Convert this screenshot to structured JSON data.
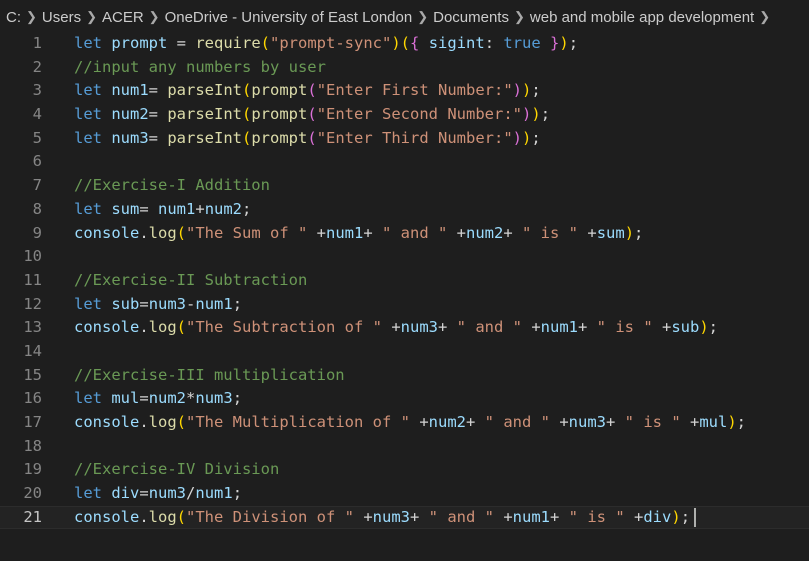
{
  "breadcrumb": [
    "C:",
    "Users",
    "ACER",
    "OneDrive - University of East London",
    "Documents",
    "web and mobile app development"
  ],
  "editor": {
    "current_line": 21,
    "lines": [
      {
        "n": "1",
        "t": [
          [
            "kw",
            "let"
          ],
          [
            "pl",
            " "
          ],
          [
            "var",
            "prompt"
          ],
          [
            "pl",
            " = "
          ],
          [
            "fn",
            "require"
          ],
          [
            "b1",
            "("
          ],
          [
            "str",
            "\"prompt-sync\""
          ],
          [
            "b1",
            ")("
          ],
          [
            "b2",
            "{"
          ],
          [
            "pl",
            " "
          ],
          [
            "var",
            "sigint"
          ],
          [
            "pl",
            ": "
          ],
          [
            "kw",
            "true"
          ],
          [
            "pl",
            " "
          ],
          [
            "b2",
            "}"
          ],
          [
            "b1",
            ")"
          ],
          [
            "pl",
            ";"
          ]
        ]
      },
      {
        "n": "2",
        "t": [
          [
            "cmt",
            "//input any numbers by user"
          ]
        ]
      },
      {
        "n": "3",
        "t": [
          [
            "kw",
            "let"
          ],
          [
            "pl",
            " "
          ],
          [
            "var",
            "num1"
          ],
          [
            "pl",
            "= "
          ],
          [
            "fn",
            "parseInt"
          ],
          [
            "b1",
            "("
          ],
          [
            "fn",
            "prompt"
          ],
          [
            "b2",
            "("
          ],
          [
            "str",
            "\"Enter First Number:\""
          ],
          [
            "b2",
            ")"
          ],
          [
            "b1",
            ")"
          ],
          [
            "pl",
            ";"
          ]
        ]
      },
      {
        "n": "4",
        "t": [
          [
            "kw",
            "let"
          ],
          [
            "pl",
            " "
          ],
          [
            "var",
            "num2"
          ],
          [
            "pl",
            "= "
          ],
          [
            "fn",
            "parseInt"
          ],
          [
            "b1",
            "("
          ],
          [
            "fn",
            "prompt"
          ],
          [
            "b2",
            "("
          ],
          [
            "str",
            "\"Enter Second Number:\""
          ],
          [
            "b2",
            ")"
          ],
          [
            "b1",
            ")"
          ],
          [
            "pl",
            ";"
          ]
        ]
      },
      {
        "n": "5",
        "t": [
          [
            "kw",
            "let"
          ],
          [
            "pl",
            " "
          ],
          [
            "var",
            "num3"
          ],
          [
            "pl",
            "= "
          ],
          [
            "fn",
            "parseInt"
          ],
          [
            "b1",
            "("
          ],
          [
            "fn",
            "prompt"
          ],
          [
            "b2",
            "("
          ],
          [
            "str",
            "\"Enter Third Number:\""
          ],
          [
            "b2",
            ")"
          ],
          [
            "b1",
            ")"
          ],
          [
            "pl",
            ";"
          ]
        ]
      },
      {
        "n": "6",
        "t": []
      },
      {
        "n": "7",
        "t": [
          [
            "cmt",
            "//Exercise-I Addition"
          ]
        ]
      },
      {
        "n": "8",
        "t": [
          [
            "kw",
            "let"
          ],
          [
            "pl",
            " "
          ],
          [
            "var",
            "sum"
          ],
          [
            "pl",
            "= "
          ],
          [
            "var",
            "num1"
          ],
          [
            "pl",
            "+"
          ],
          [
            "var",
            "num2"
          ],
          [
            "pl",
            ";"
          ]
        ]
      },
      {
        "n": "9",
        "t": [
          [
            "var",
            "console"
          ],
          [
            "pl",
            "."
          ],
          [
            "fn",
            "log"
          ],
          [
            "b1",
            "("
          ],
          [
            "str",
            "\"The Sum of \""
          ],
          [
            "pl",
            " +"
          ],
          [
            "var",
            "num1"
          ],
          [
            "pl",
            "+ "
          ],
          [
            "str",
            "\" and \""
          ],
          [
            "pl",
            " +"
          ],
          [
            "var",
            "num2"
          ],
          [
            "pl",
            "+ "
          ],
          [
            "str",
            "\" is \""
          ],
          [
            "pl",
            " +"
          ],
          [
            "var",
            "sum"
          ],
          [
            "b1",
            ")"
          ],
          [
            "pl",
            ";"
          ]
        ]
      },
      {
        "n": "10",
        "t": []
      },
      {
        "n": "11",
        "t": [
          [
            "cmt",
            "//Exercise-II Subtraction"
          ]
        ]
      },
      {
        "n": "12",
        "t": [
          [
            "kw",
            "let"
          ],
          [
            "pl",
            " "
          ],
          [
            "var",
            "sub"
          ],
          [
            "pl",
            "="
          ],
          [
            "var",
            "num3"
          ],
          [
            "pl",
            "-"
          ],
          [
            "var",
            "num1"
          ],
          [
            "pl",
            ";"
          ]
        ]
      },
      {
        "n": "13",
        "t": [
          [
            "var",
            "console"
          ],
          [
            "pl",
            "."
          ],
          [
            "fn",
            "log"
          ],
          [
            "b1",
            "("
          ],
          [
            "str",
            "\"The Subtraction of \""
          ],
          [
            "pl",
            " +"
          ],
          [
            "var",
            "num3"
          ],
          [
            "pl",
            "+ "
          ],
          [
            "str",
            "\" and \""
          ],
          [
            "pl",
            " +"
          ],
          [
            "var",
            "num1"
          ],
          [
            "pl",
            "+ "
          ],
          [
            "str",
            "\" is \""
          ],
          [
            "pl",
            " +"
          ],
          [
            "var",
            "sub"
          ],
          [
            "b1",
            ")"
          ],
          [
            "pl",
            ";"
          ]
        ]
      },
      {
        "n": "14",
        "t": []
      },
      {
        "n": "15",
        "t": [
          [
            "cmt",
            "//Exercise-III multiplication"
          ]
        ]
      },
      {
        "n": "16",
        "t": [
          [
            "kw",
            "let"
          ],
          [
            "pl",
            " "
          ],
          [
            "var",
            "mul"
          ],
          [
            "pl",
            "="
          ],
          [
            "var",
            "num2"
          ],
          [
            "pl",
            "*"
          ],
          [
            "var",
            "num3"
          ],
          [
            "pl",
            ";"
          ]
        ]
      },
      {
        "n": "17",
        "t": [
          [
            "var",
            "console"
          ],
          [
            "pl",
            "."
          ],
          [
            "fn",
            "log"
          ],
          [
            "b1",
            "("
          ],
          [
            "str",
            "\"The Multiplication of \""
          ],
          [
            "pl",
            " +"
          ],
          [
            "var",
            "num2"
          ],
          [
            "pl",
            "+ "
          ],
          [
            "str",
            "\" and \""
          ],
          [
            "pl",
            " +"
          ],
          [
            "var",
            "num3"
          ],
          [
            "pl",
            "+ "
          ],
          [
            "str",
            "\" is \""
          ],
          [
            "pl",
            " +"
          ],
          [
            "var",
            "mul"
          ],
          [
            "b1",
            ")"
          ],
          [
            "pl",
            ";"
          ]
        ]
      },
      {
        "n": "18",
        "t": []
      },
      {
        "n": "19",
        "t": [
          [
            "cmt",
            "//Exercise-IV Division"
          ]
        ]
      },
      {
        "n": "20",
        "t": [
          [
            "kw",
            "let"
          ],
          [
            "pl",
            " "
          ],
          [
            "var",
            "div"
          ],
          [
            "pl",
            "="
          ],
          [
            "var",
            "num3"
          ],
          [
            "pl",
            "/"
          ],
          [
            "var",
            "num1"
          ],
          [
            "pl",
            ";"
          ]
        ]
      },
      {
        "n": "21",
        "t": [
          [
            "var",
            "console"
          ],
          [
            "pl",
            "."
          ],
          [
            "fn",
            "log"
          ],
          [
            "b1",
            "("
          ],
          [
            "str",
            "\"The Division of \""
          ],
          [
            "pl",
            " +"
          ],
          [
            "var",
            "num3"
          ],
          [
            "pl",
            "+ "
          ],
          [
            "str",
            "\" and \""
          ],
          [
            "pl",
            " +"
          ],
          [
            "var",
            "num1"
          ],
          [
            "pl",
            "+ "
          ],
          [
            "str",
            "\" is \""
          ],
          [
            "pl",
            " +"
          ],
          [
            "var",
            "div"
          ],
          [
            "b1",
            ")"
          ],
          [
            "pl",
            ";"
          ]
        ]
      }
    ]
  }
}
